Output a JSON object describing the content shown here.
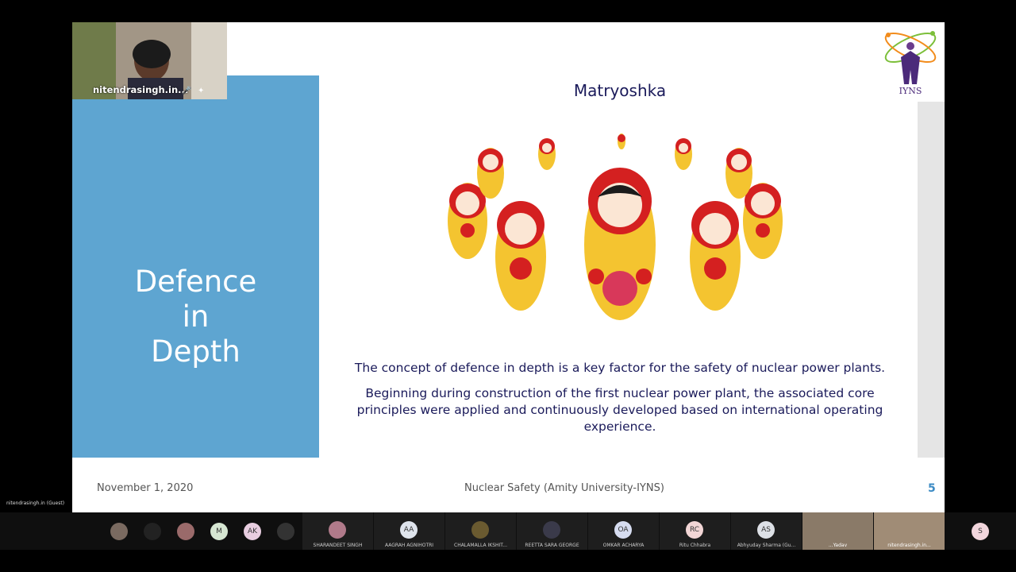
{
  "slide": {
    "heading_lines": [
      "Defence",
      "in",
      "Depth"
    ],
    "subtitle": "Matryoshka",
    "paragraph1": "The concept of defence in depth is a key factor for the safety of nuclear power plants.",
    "paragraph2": "Beginning during construction of the first nuclear power plant, the associated core principles were applied and continuously developed based on international operating experience.",
    "footer_date": "November 1, 2020",
    "footer_course": "Nuclear Safety (Amity University-IYNS)",
    "page_number": "5",
    "logo_text": "IYNS"
  },
  "self_video": {
    "name": "nitendrasingh.in...",
    "guest_label": "nitendrasingh.in (Guest)"
  },
  "participants": [
    {
      "initials": "",
      "type": "photo"
    },
    {
      "initials": "",
      "type": "photo"
    },
    {
      "initials": "",
      "type": "photo"
    },
    {
      "initials": "M",
      "type": "initial",
      "color": "#d6e6d2"
    },
    {
      "initials": "AK",
      "type": "initial",
      "color": "#e8cde0"
    },
    {
      "initials": "",
      "type": "photo"
    },
    {
      "initials": "",
      "type": "photo",
      "name": "SHARANDEET SINGH"
    },
    {
      "initials": "AA",
      "type": "initial",
      "color": "#dfe4ec",
      "name": "AAGRAH AGNIHOTRI"
    },
    {
      "initials": "",
      "type": "photo",
      "name": "CHALAMALLA IKSHIT..."
    },
    {
      "initials": "",
      "type": "photo",
      "name": "REETTA SARA GEORGE"
    },
    {
      "initials": "OA",
      "type": "initial",
      "color": "#d6dcf0",
      "name": "OMKAR ACHARYA"
    },
    {
      "initials": "RC",
      "type": "initial",
      "color": "#f2d6d6",
      "name": "Ritu Chhabra"
    },
    {
      "initials": "AS",
      "type": "initial",
      "color": "#dde0e6",
      "name": "Abhyuday Sharma (Gu..."
    },
    {
      "initials": "",
      "type": "video",
      "name": "...Yadav"
    },
    {
      "initials": "",
      "type": "video",
      "name": "nitendrasingh.in..."
    },
    {
      "initials": "S",
      "type": "initial",
      "color": "#f1d5dc"
    }
  ]
}
